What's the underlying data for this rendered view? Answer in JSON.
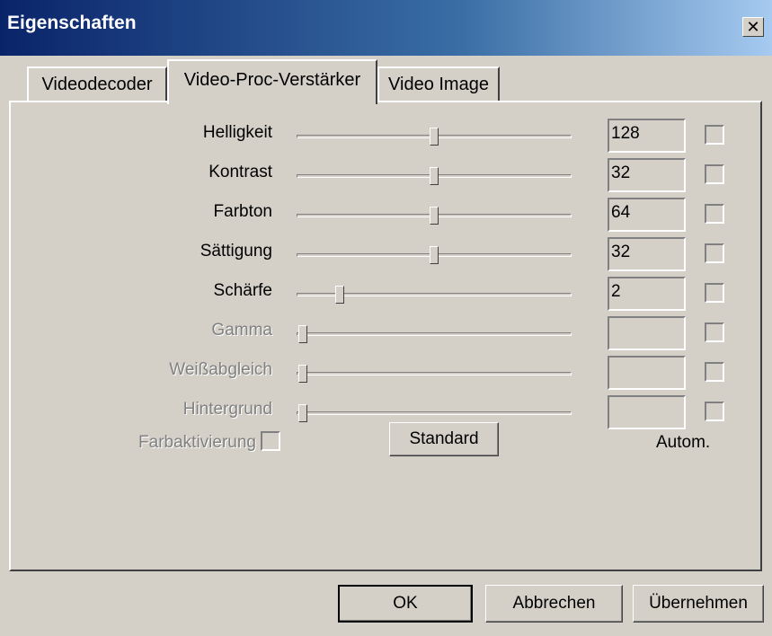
{
  "window": {
    "title": "Eigenschaften",
    "close_label": "✕"
  },
  "tabs": [
    {
      "label": "Videodecoder",
      "active": false
    },
    {
      "label": "Video-Proc-Verstärker",
      "active": true
    },
    {
      "label": "Video Image",
      "active": false
    }
  ],
  "properties": [
    {
      "label": "Helligkeit",
      "value": "128",
      "slider": 0.5,
      "enabled": true,
      "auto": false
    },
    {
      "label": "Kontrast",
      "value": "32",
      "slider": 0.5,
      "enabled": true,
      "auto": false
    },
    {
      "label": "Farbton",
      "value": "64",
      "slider": 0.5,
      "enabled": true,
      "auto": false
    },
    {
      "label": "Sättigung",
      "value": "32",
      "slider": 0.5,
      "enabled": true,
      "auto": false
    },
    {
      "label": "Schärfe",
      "value": "2",
      "slider": 0.14,
      "enabled": true,
      "auto": false
    },
    {
      "label": "Gamma",
      "value": "",
      "slider": 0.0,
      "enabled": false,
      "auto": false
    },
    {
      "label": "Weißabgleich",
      "value": "",
      "slider": 0.0,
      "enabled": false,
      "auto": false
    },
    {
      "label": "Hintergrund",
      "value": "",
      "slider": 0.0,
      "enabled": false,
      "auto": false
    }
  ],
  "color_enable": {
    "label": "Farbaktivierung",
    "checked": false,
    "enabled": false
  },
  "standard_button": "Standard",
  "autom_label": "Autom.",
  "buttons": {
    "ok": "OK",
    "cancel": "Abbrechen",
    "apply": "Übernehmen"
  }
}
